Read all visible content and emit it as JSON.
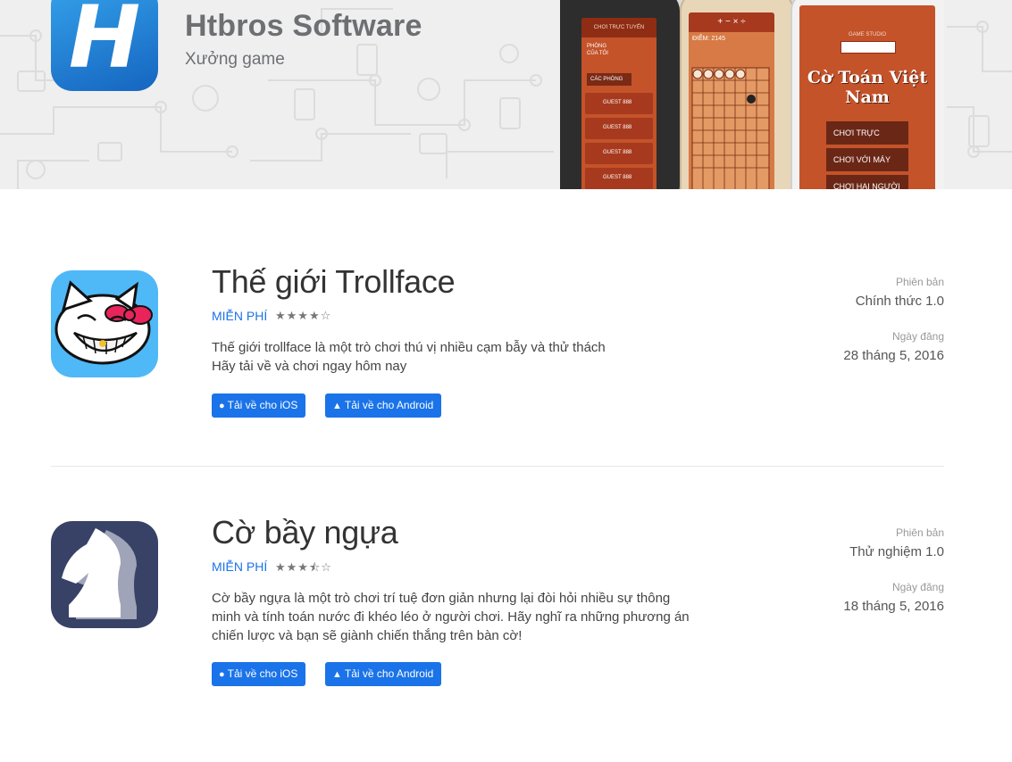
{
  "header": {
    "developer_name": "Htbros Software",
    "developer_subtitle": "Xưởng game",
    "logo_letter": "H",
    "screens": {
      "left": {
        "top_label": "CHƠI TRỰC TUYẾN",
        "my_room": "PHÒNG CỦA TÔI",
        "rooms_label": "CÁC PHÒNG",
        "rooms": [
          "GUEST 888",
          "GUEST 888",
          "GUEST 888",
          "GUEST 888"
        ]
      },
      "middle": {
        "score_label": "ĐIỂM: 2145",
        "ops": "+ − × ÷"
      },
      "right": {
        "studio": "GAME STUDIO",
        "game_title": "Cờ Toán Việt Nam",
        "menu": [
          "CHƠI TRỰC TUYẾN",
          "CHƠI VỚI MÁY",
          "CHƠI HAI NGƯỜI"
        ]
      }
    }
  },
  "apps": [
    {
      "title": "Thế giới Trollface",
      "price": "MIỄN PHÍ",
      "rating": "★★★★☆",
      "description": [
        "Thế giới trollface là một trò chơi thú vị nhiều cạm bẫy và thử thách",
        "Hãy tải về và chơi ngay hôm nay"
      ],
      "ios_button": "Tải về cho iOS",
      "android_button": "Tải về cho Android",
      "version_label": "Phiên bản",
      "version": "Chính thức 1.0",
      "date_label": "Ngày đăng",
      "date": "28 tháng 5, 2016"
    },
    {
      "title": "Cờ bầy ngựa",
      "price": "MIỄN PHÍ",
      "rating": "★★★⯪☆",
      "description": [
        "Cờ bầy ngựa là một trò chơi trí tuệ đơn giản nhưng lại đòi hỏi nhiều sự thông",
        "minh và tính toán nước đi khéo léo ở người chơi. Hãy nghĩ ra những phương án",
        "chiến lược và bạn sẽ giành chiến thắng trên bàn cờ!"
      ],
      "ios_button": "Tải về cho iOS",
      "android_button": "Tải về cho Android",
      "version_label": "Phiên bản",
      "version": "Thử nghiệm 1.0",
      "date_label": "Ngày đăng",
      "date": "18 tháng 5, 2016"
    }
  ],
  "colors": {
    "accent": "#1a73e8",
    "banner_bg": "#efefef",
    "game_red": "#c4532a"
  }
}
